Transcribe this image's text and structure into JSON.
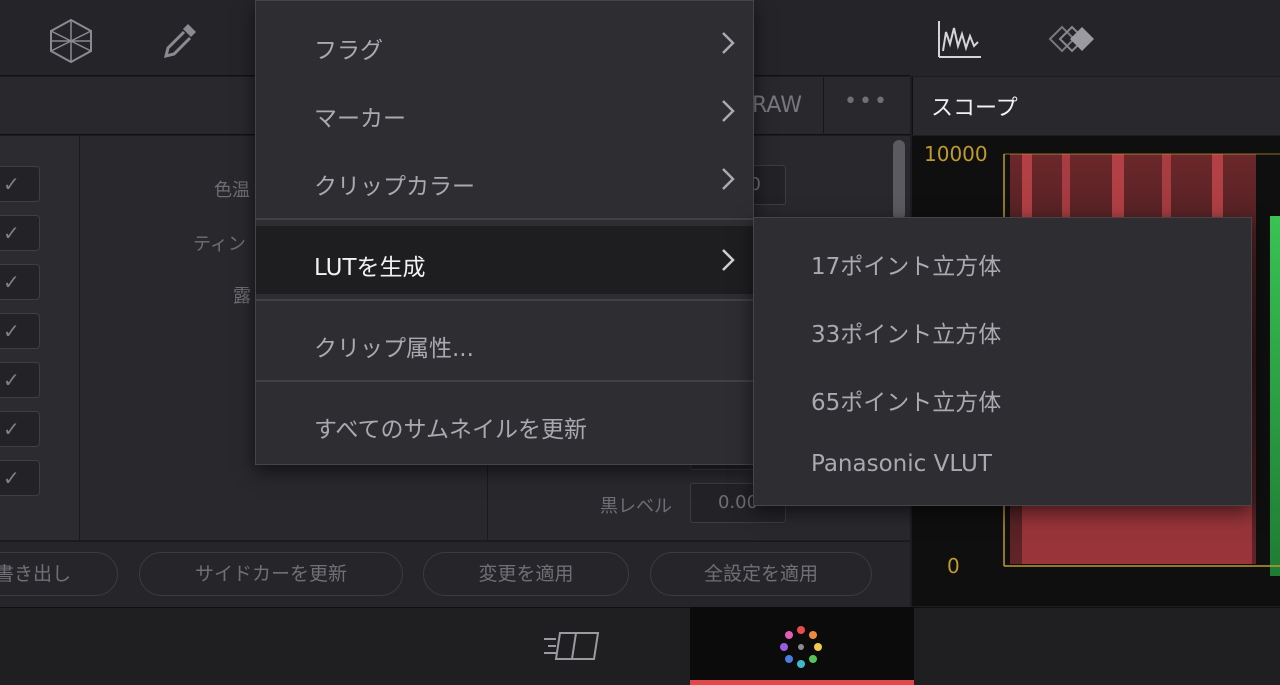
{
  "toolbar": {
    "icons": [
      "node-network-icon",
      "eyedropper-icon",
      "scope-waveform-icon",
      "keyframes-icon"
    ]
  },
  "header": {
    "raw_tab_label": "RAW",
    "more_label": "•••",
    "scope_title": "スコープ"
  },
  "params": {
    "labels": [
      "色温",
      "ティン",
      "露",
      "黒レベル"
    ],
    "black_level_value": "0.00",
    "partial_value": "0"
  },
  "buttons": {
    "export_label": "書き出し",
    "update_sidecar_label": "サイドカーを更新",
    "apply_changes_label": "変更を適用",
    "apply_all_label": "全設定を適用"
  },
  "scope": {
    "max_label": "10000",
    "min_label": "0"
  },
  "context_menu": {
    "items": [
      {
        "label": "フラグ",
        "has_submenu": true
      },
      {
        "label": "マーカー",
        "has_submenu": true
      },
      {
        "label": "クリップカラー",
        "has_submenu": true
      },
      {
        "label": "LUTを生成",
        "has_submenu": true
      },
      {
        "label": "クリップ属性...",
        "has_submenu": false
      },
      {
        "label": "すべてのサムネイルを更新",
        "has_submenu": false
      }
    ]
  },
  "submenu": {
    "items": [
      {
        "label": "17ポイント立方体"
      },
      {
        "label": "33ポイント立方体"
      },
      {
        "label": "65ポイント立方体"
      },
      {
        "label": "Panasonic VLUT"
      }
    ]
  },
  "colors": {
    "accent_red": "#e0484a",
    "scope_gold": "#c09a2b",
    "menu_bg": "#2d2d32",
    "menu_active_bg": "#1e1e21"
  }
}
